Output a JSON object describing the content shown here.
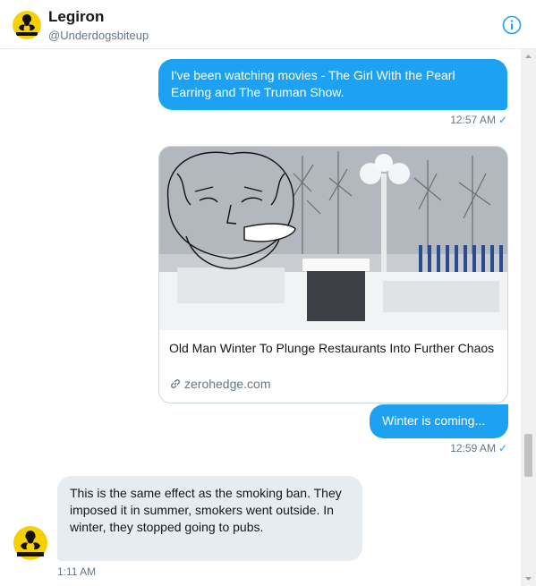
{
  "header": {
    "name": "Legiron",
    "handle": "@Underdogsbiteup",
    "avatar_badge": "Biohazard"
  },
  "messages": [
    {
      "text": "I've been watching movies - The Girl With the Pearl Earring and The Truman Show.",
      "time": "12:57 AM",
      "direction": "sent"
    },
    {
      "card": {
        "title": "Old Man Winter To Plunge Restaurants Into Further Chaos",
        "domain": "zerohedge.com"
      },
      "text": "Winter is coming...",
      "time": "12:59 AM",
      "direction": "sent"
    },
    {
      "text": "This is the same effect as the smoking ban. They imposed it in summer, smokers went outside. In winter, they stopped going to pubs.",
      "time": "1:11 AM",
      "direction": "received"
    }
  ],
  "colors": {
    "accent": "#1da1f2",
    "received_bubble": "#e6ecf0",
    "muted_text": "#657786"
  },
  "icons": {
    "info": "info-icon",
    "read_receipt": "checkmark-icon",
    "link": "link-icon"
  }
}
